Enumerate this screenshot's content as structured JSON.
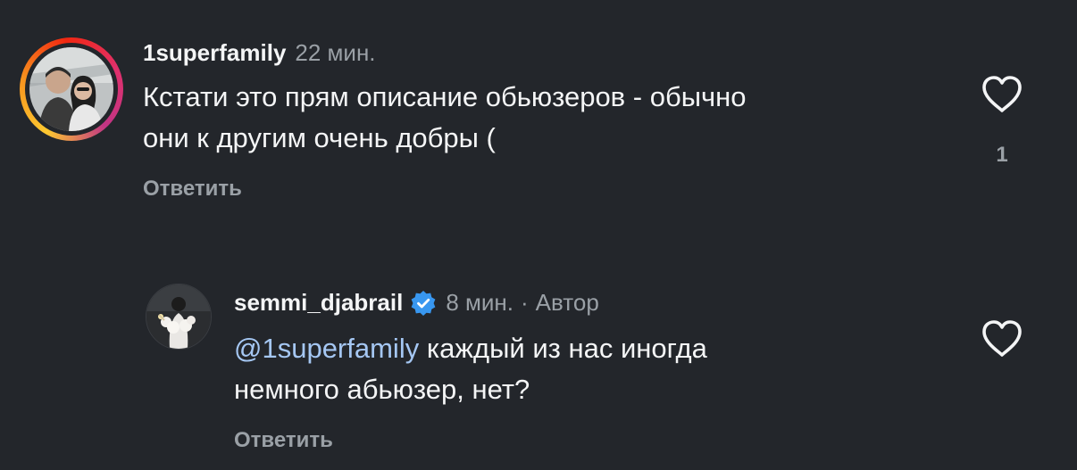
{
  "comments": [
    {
      "username": "1superfamily",
      "time": "22 мин.",
      "text_line1": "Кстати это прям описание обьюзеров - обычно",
      "text_line2": "они к другим очень добры (",
      "reply_label": "Ответить",
      "like_count": "1",
      "like_icon": "heart-outline-icon"
    },
    {
      "username": "semmi_djabrail",
      "verified_icon": "verified-badge-icon",
      "time": "8 мин.",
      "separator": "·",
      "author_label": "Автор",
      "mention": "@1superfamily",
      "text_line1_rest": " каждый из нас иногда",
      "text_line2": "немного абьюзер, нет?",
      "reply_label": "Ответить",
      "like_icon": "heart-outline-icon"
    }
  ],
  "colors": {
    "background": "#23262b",
    "primary_text": "#f4f5f6",
    "secondary_text": "#9aa0a6",
    "mention": "#a5c7f3",
    "verified": "#3897f0"
  }
}
